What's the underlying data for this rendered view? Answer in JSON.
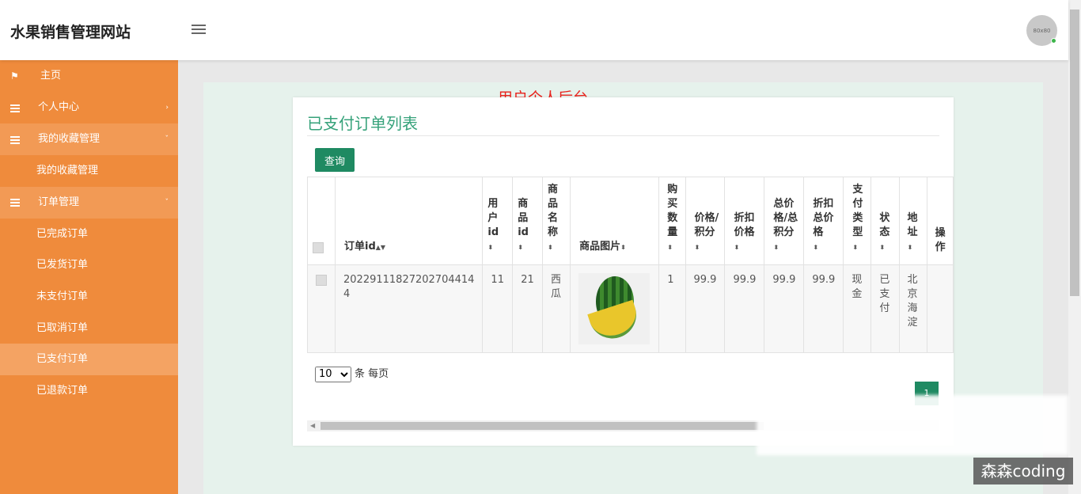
{
  "brand": "水果销售管理网站",
  "avatar_text": "80x80",
  "sidebar": {
    "home": "主页",
    "personal": "个人中心",
    "favorites_group": "我的收藏管理",
    "favorites_item": "我的收藏管理",
    "orders_group": "订单管理",
    "orders": [
      "已完成订单",
      "已发货订单",
      "未支付订单",
      "已取消订单",
      "已支付订单",
      "已退款订单"
    ]
  },
  "page_heading": "用户个人后台",
  "card": {
    "title": "已支付订单列表",
    "query_button": "查询"
  },
  "table": {
    "headers": [
      "订单id",
      "用户id",
      "商品id",
      "商品名称",
      "商品图片",
      "购买数量",
      "价格/积分",
      "折扣价格",
      "总价格/总积分",
      "折扣总价格",
      "支付类型",
      "状态",
      "地址",
      "操作"
    ],
    "row": {
      "order_id": "20229111827202704414​4",
      "user_id": "11",
      "product_id": "21",
      "product_name": "西瓜",
      "quantity": "1",
      "price": "99.9",
      "discount_price": "99.9",
      "total_price": "99.9",
      "discount_total": "99.9",
      "pay_type": "现金",
      "status": "已支付",
      "address": "北京海淀"
    }
  },
  "pager": {
    "page_size": "10",
    "page_size_suffix": "条 每页",
    "current_page": "1"
  },
  "watermark": "森森coding",
  "colors": {
    "sidebar": "#ef8b3c",
    "accent_green": "#1f8a62",
    "heading_red": "#e8221c"
  }
}
